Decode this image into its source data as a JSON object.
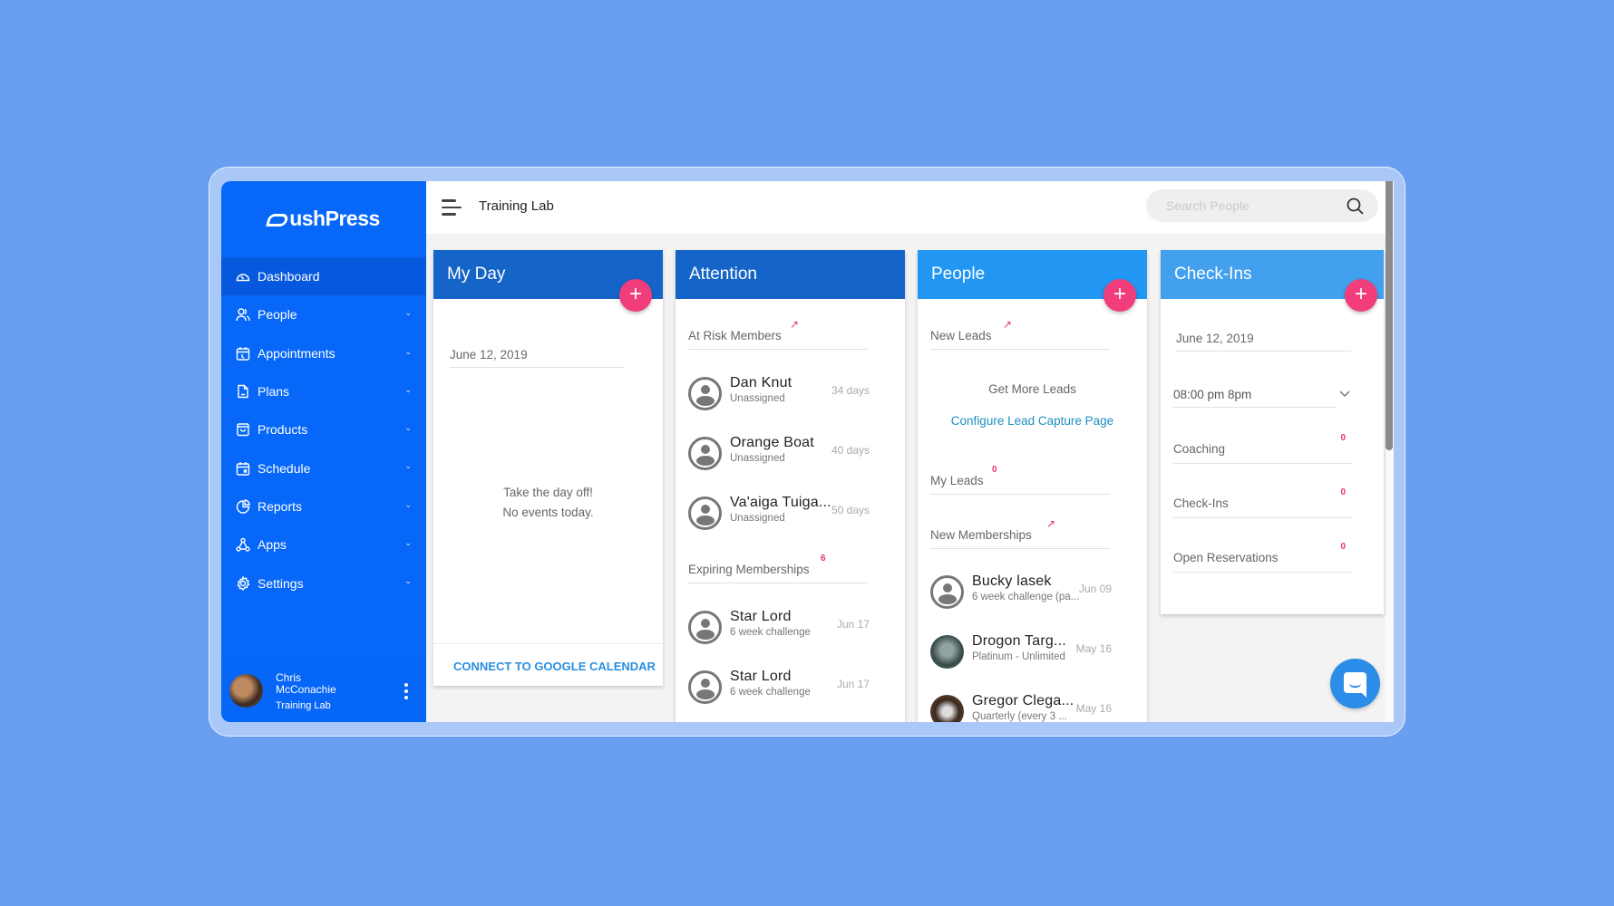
{
  "app": {
    "name": "PushPress",
    "workspace": "Training Lab"
  },
  "sidebar": {
    "items": [
      {
        "label": "Dashboard",
        "icon": "dashboard-gauge-icon",
        "active": true,
        "has_chevron": false
      },
      {
        "label": "People",
        "icon": "people-icon",
        "has_chevron": true
      },
      {
        "label": "Appointments",
        "icon": "calendar-clock-icon",
        "has_chevron": true
      },
      {
        "label": "Plans",
        "icon": "document-icon",
        "has_chevron": true
      },
      {
        "label": "Products",
        "icon": "shopping-bag-icon",
        "has_chevron": true
      },
      {
        "label": "Schedule",
        "icon": "calendar-icon",
        "has_chevron": true
      },
      {
        "label": "Reports",
        "icon": "pie-chart-icon",
        "has_chevron": true
      },
      {
        "label": "Apps",
        "icon": "apps-network-icon",
        "has_chevron": true
      },
      {
        "label": "Settings",
        "icon": "gear-icon",
        "has_chevron": true
      }
    ],
    "user": {
      "first_name": "Chris",
      "last_name": "McConachie",
      "org": "Training Lab"
    }
  },
  "header": {
    "title": "Training Lab",
    "search_placeholder": "Search People",
    "search_value": ""
  },
  "cards": {
    "my_day": {
      "title": "My Day",
      "date": "June 12, 2019",
      "empty_line1": "Take the day off!",
      "empty_line2": "No events today.",
      "connect_label": "CONNECT TO GOOGLE CALENDAR"
    },
    "attention": {
      "title": "Attention",
      "at_risk": {
        "title": "At Risk Members",
        "rows": [
          {
            "name": "Dan Knut",
            "sub": "Unassigned",
            "meta": "34 days"
          },
          {
            "name": "Orange Boat",
            "sub": "Unassigned",
            "meta": "40 days"
          },
          {
            "name": "Va'aiga Tuiga...",
            "sub": "Unassigned",
            "meta": "50 days"
          }
        ]
      },
      "expiring": {
        "title": "Expiring Memberships",
        "count": "6",
        "rows": [
          {
            "name": "Star Lord",
            "sub": "6 week challenge",
            "meta": "Jun 17"
          },
          {
            "name": "Star Lord",
            "sub": "6 week challenge",
            "meta": "Jun 17"
          }
        ]
      }
    },
    "people": {
      "title": "People",
      "new_leads": {
        "title": "New Leads",
        "get_more": "Get More Leads",
        "configure_link": "Configure Lead Capture Page"
      },
      "my_leads": {
        "title": "My Leads",
        "count": "0"
      },
      "new_memberships": {
        "title": "New Memberships",
        "rows": [
          {
            "name": "Bucky lasek",
            "sub": "6 week challenge (pa...",
            "meta": "Jun 09"
          },
          {
            "name": "Drogon Targ...",
            "sub": "Platinum - Unlimited",
            "meta": "May 16"
          },
          {
            "name": "Gregor Clega...",
            "sub": "Quarterly (every 3 ...",
            "meta": "May 16"
          }
        ]
      }
    },
    "checkins": {
      "title": "Check-Ins",
      "date": "June 12, 2019",
      "time_select": "08:00 pm 8pm",
      "stats": [
        {
          "label": "Coaching",
          "count": "0"
        },
        {
          "label": "Check-Ins",
          "count": "0"
        },
        {
          "label": "Open Reservations",
          "count": "0"
        }
      ]
    }
  },
  "colors": {
    "background": "#6a9ff0",
    "sidebar": "#0667f9",
    "my_day_header": "#1565c8",
    "attention_header": "#1565c8",
    "people_header": "#2196f3",
    "checkins_header": "#42a0ee",
    "fab": "#f23d7d",
    "badge": "#e8336e",
    "link": "#1e8fbf"
  }
}
